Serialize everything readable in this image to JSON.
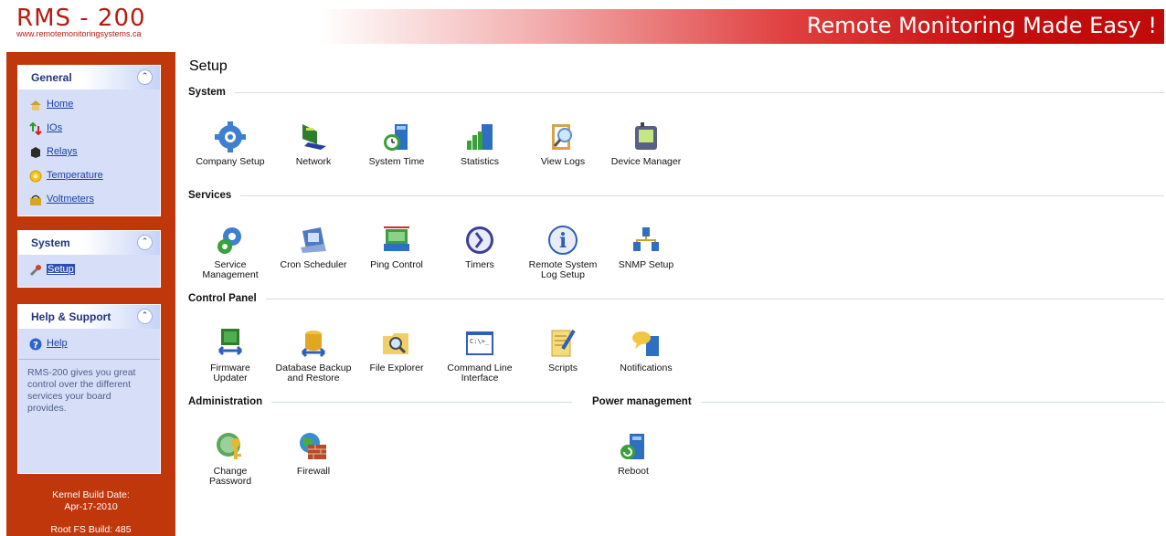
{
  "header": {
    "logo_title": "RMS - 200",
    "logo_url": "www.remotemonitoringsystems.ca",
    "tagline": "Remote Monitoring Made Easy !"
  },
  "sidebar": {
    "general": {
      "title": "General",
      "items": [
        {
          "label": "Home",
          "icon": "home-icon"
        },
        {
          "label": "IOs",
          "icon": "ios-icon"
        },
        {
          "label": "Relays",
          "icon": "relays-icon"
        },
        {
          "label": "Temperature",
          "icon": "temperature-icon"
        },
        {
          "label": "Voltmeters",
          "icon": "voltmeters-icon"
        }
      ]
    },
    "system": {
      "title": "System",
      "items": [
        {
          "label": "Setup",
          "icon": "wrench-icon",
          "selected": true
        }
      ]
    },
    "help": {
      "title": "Help & Support",
      "items": [
        {
          "label": "Help",
          "icon": "help-icon"
        }
      ],
      "text": "RMS-200 gives you great control over the different services your board provides."
    },
    "footer": {
      "kernel_label": "Kernel Build Date:",
      "kernel_date": "Apr-17-2010",
      "rootfs_label": "Root FS Build: 485"
    }
  },
  "main": {
    "title": "Setup",
    "sections": {
      "system": {
        "title": "System",
        "tools": [
          {
            "label": [
              "Company Setup"
            ],
            "icon": "gear-icon"
          },
          {
            "label": [
              "Network"
            ],
            "icon": "network-icon"
          },
          {
            "label": [
              "System Time"
            ],
            "icon": "clock-icon"
          },
          {
            "label": [
              "Statistics"
            ],
            "icon": "chart-icon"
          },
          {
            "label": [
              "View Logs"
            ],
            "icon": "clipboard-search-icon"
          },
          {
            "label": [
              "Device Manager"
            ],
            "icon": "device-icon"
          }
        ]
      },
      "services": {
        "title": "Services",
        "tools": [
          {
            "label": [
              "Service",
              "Management"
            ],
            "icon": "service-gear-icon"
          },
          {
            "label": [
              "Cron Scheduler"
            ],
            "icon": "scheduler-icon"
          },
          {
            "label": [
              "Ping Control"
            ],
            "icon": "ping-icon"
          },
          {
            "label": [
              "Timers"
            ],
            "icon": "timer-icon"
          },
          {
            "label": [
              "Remote System",
              "Log Setup"
            ],
            "icon": "info-icon"
          },
          {
            "label": [
              "SNMP Setup"
            ],
            "icon": "snmp-network-icon"
          }
        ]
      },
      "control_panel": {
        "title": "Control Panel",
        "tools": [
          {
            "label": [
              "Firmware",
              "Updater"
            ],
            "icon": "firmware-chip-icon"
          },
          {
            "label": [
              "Database Backup",
              "and Restore"
            ],
            "icon": "database-icon"
          },
          {
            "label": [
              "File Explorer"
            ],
            "icon": "folder-search-icon"
          },
          {
            "label": [
              "Command Line",
              "Interface"
            ],
            "icon": "terminal-icon"
          },
          {
            "label": [
              "Scripts"
            ],
            "icon": "script-pencil-icon"
          },
          {
            "label": [
              "Notifications"
            ],
            "icon": "notification-icon"
          }
        ]
      },
      "administration": {
        "title": "Administration",
        "tools": [
          {
            "label": [
              "Change",
              "Password"
            ],
            "icon": "key-icon"
          },
          {
            "label": [
              "Firewall"
            ],
            "icon": "firewall-icon"
          }
        ]
      },
      "power": {
        "title": "Power management",
        "tools": [
          {
            "label": [
              "Reboot"
            ],
            "icon": "reboot-icon"
          }
        ]
      }
    }
  },
  "colors": {
    "brand_red": "#b81b12",
    "sidebar_bg": "#c0370c",
    "panel_bg": "#d6dff7",
    "panel_title": "#21347e",
    "link": "#1b3fa6"
  }
}
